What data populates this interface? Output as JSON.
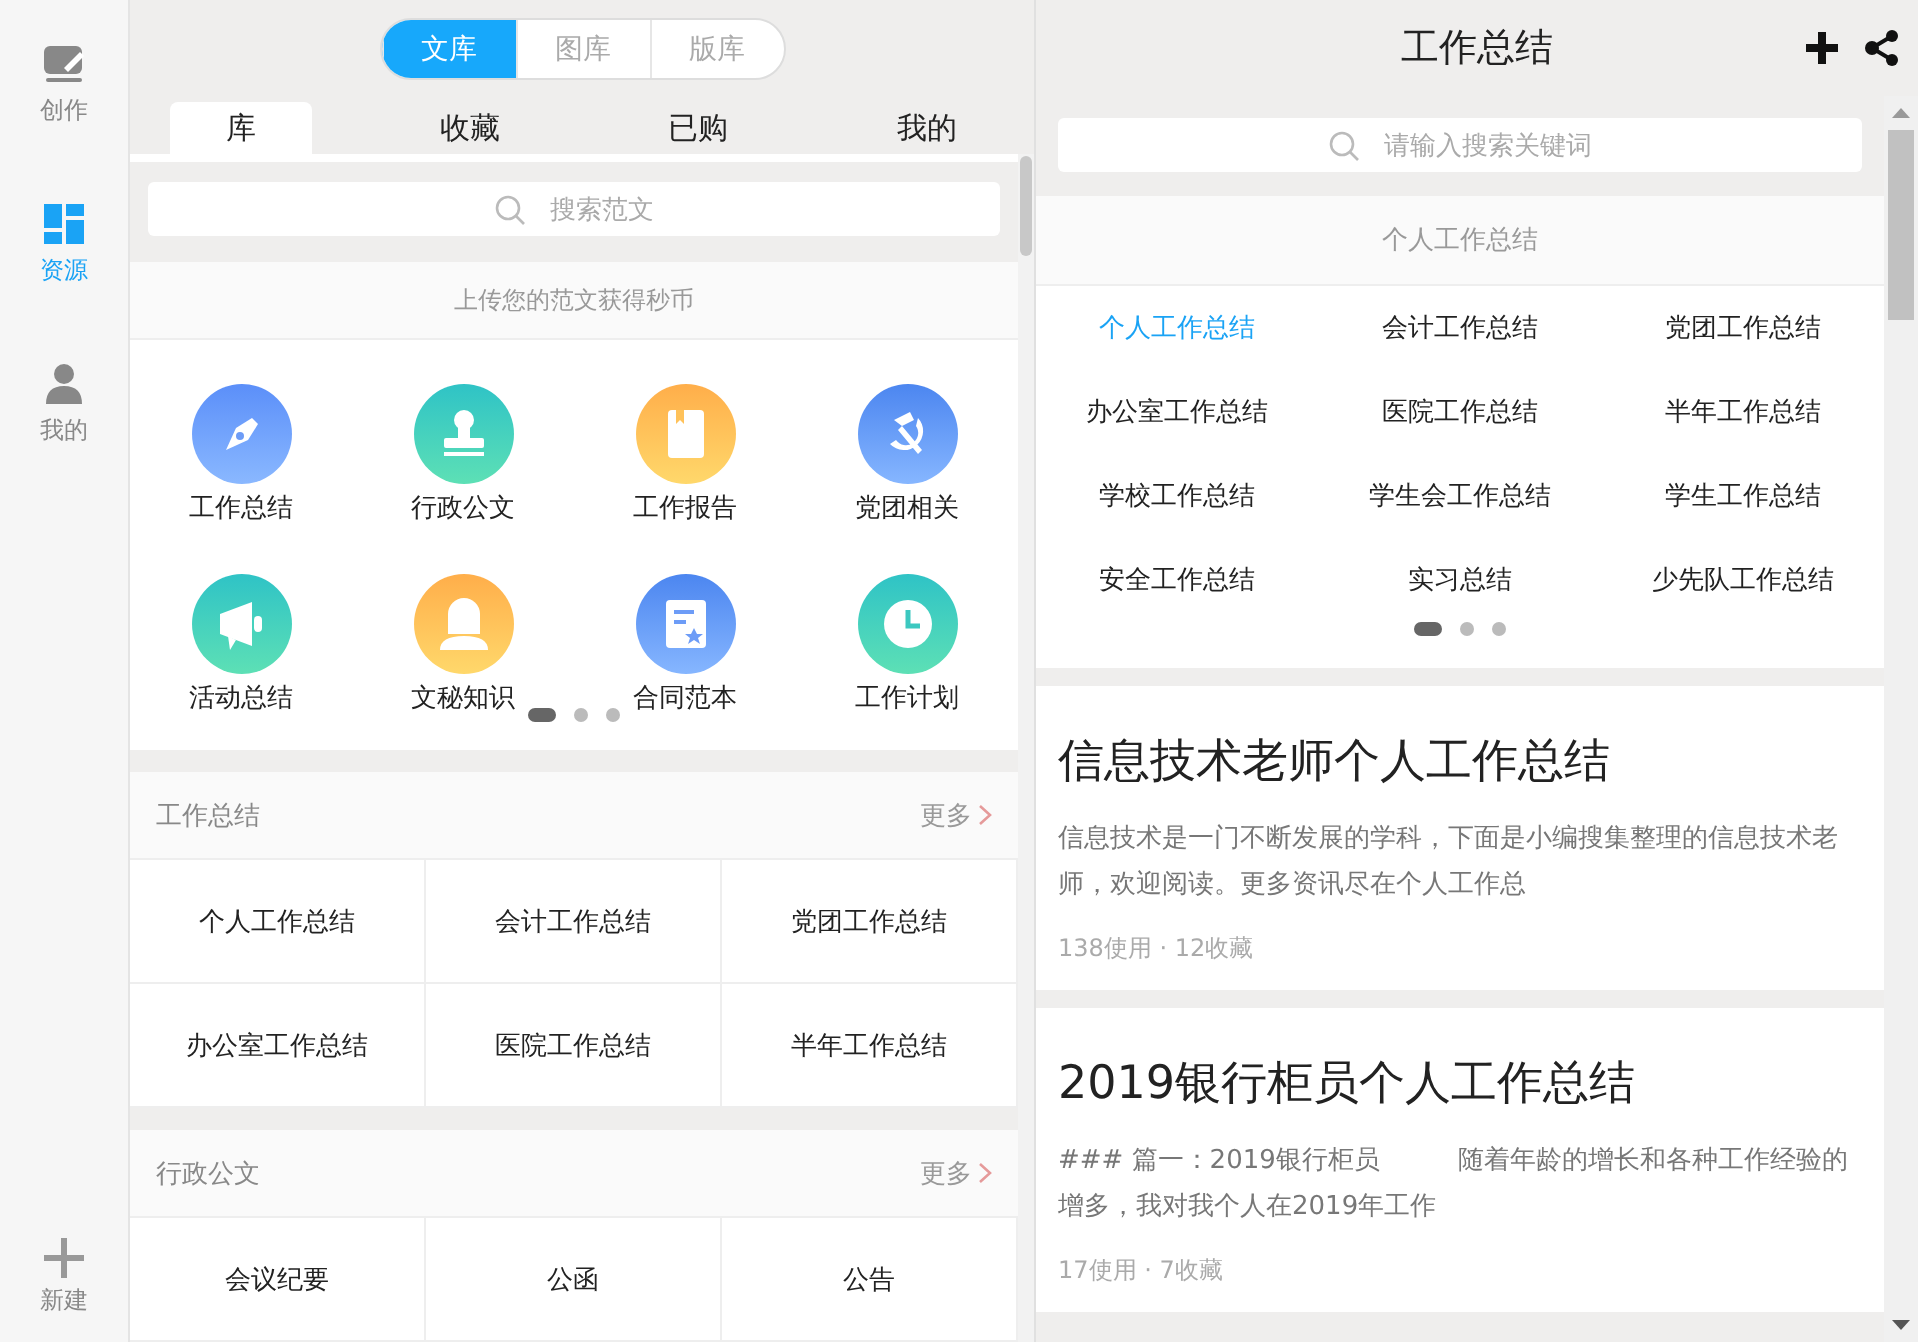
{
  "sidebar": {
    "items": [
      {
        "label": "创作",
        "selected": false
      },
      {
        "label": "资源",
        "selected": true
      },
      {
        "label": "我的",
        "selected": false
      }
    ],
    "new_label": "新建"
  },
  "library": {
    "segments": [
      {
        "label": "文库",
        "selected": true
      },
      {
        "label": "图库",
        "selected": false
      },
      {
        "label": "版库",
        "selected": false
      }
    ],
    "tabs": [
      {
        "label": "库",
        "selected": true
      },
      {
        "label": "收藏",
        "selected": false
      },
      {
        "label": "已购",
        "selected": false
      },
      {
        "label": "我的",
        "selected": false
      }
    ],
    "search": {
      "placeholder": "搜索范文"
    },
    "banner": "上传您的范文获得秒币",
    "categories": [
      {
        "label": "工作总结"
      },
      {
        "label": "行政公文"
      },
      {
        "label": "工作报告"
      },
      {
        "label": "党团相关"
      },
      {
        "label": "活动总结"
      },
      {
        "label": "文秘知识"
      },
      {
        "label": "合同范本"
      },
      {
        "label": "工作计划"
      }
    ],
    "page_dots": [
      {
        "selected": true
      },
      {
        "selected": false
      },
      {
        "selected": false
      }
    ],
    "sections": [
      {
        "title": "工作总结",
        "more": "更多",
        "items": [
          "个人工作总结",
          "会计工作总结",
          "党团工作总结",
          "办公室工作总结",
          "医院工作总结",
          "半年工作总结"
        ]
      },
      {
        "title": "行政公文",
        "more": "更多",
        "items": [
          "会议纪要",
          "公函",
          "公告"
        ]
      }
    ]
  },
  "detail": {
    "title": "工作总结",
    "search": {
      "placeholder": "请输入搜索关键词"
    },
    "group_title": "个人工作总结",
    "topics": [
      {
        "label": "个人工作总结",
        "selected": true
      },
      {
        "label": "会计工作总结",
        "selected": false
      },
      {
        "label": "党团工作总结",
        "selected": false
      },
      {
        "label": "办公室工作总结",
        "selected": false
      },
      {
        "label": "医院工作总结",
        "selected": false
      },
      {
        "label": "半年工作总结",
        "selected": false
      },
      {
        "label": "学校工作总结",
        "selected": false
      },
      {
        "label": "学生会工作总结",
        "selected": false
      },
      {
        "label": "学生工作总结",
        "selected": false
      },
      {
        "label": "安全工作总结",
        "selected": false
      },
      {
        "label": "实习总结",
        "selected": false
      },
      {
        "label": "少先队工作总结",
        "selected": false
      }
    ],
    "page_dots": [
      {
        "selected": true
      },
      {
        "selected": false
      },
      {
        "selected": false
      }
    ],
    "articles": [
      {
        "title": "信息技术老师个人工作总结",
        "summary": "信息技术是一门不断发展的学科，下面是小编搜集整理的信息技术老师，欢迎阅读。更多资讯尽在个人工作总",
        "meta": "138使用 · 12收藏"
      },
      {
        "title": "2019银行柜员个人工作总结",
        "summary": "### 篇一：2019银行柜员　　　随着年龄的增长和各种工作经验的增多，我对我个人在2019年工作",
        "meta": "17使用 · 7收藏"
      }
    ]
  }
}
